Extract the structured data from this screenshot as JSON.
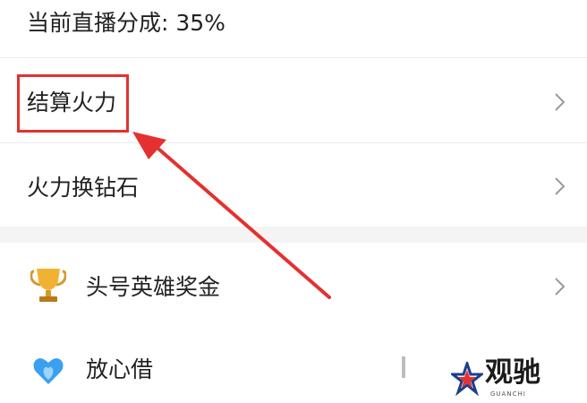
{
  "header": {
    "text": "当前直播分成: 35%"
  },
  "menu": {
    "items": [
      {
        "label": "结算火力",
        "icon": "chevron-right-icon"
      },
      {
        "label": "火力换钻石",
        "icon": "chevron-right-icon"
      }
    ]
  },
  "services": {
    "items": [
      {
        "label": "头号英雄奖金",
        "icon": "trophy-icon"
      },
      {
        "label": "放心借",
        "icon": "heart-drop-icon"
      }
    ]
  },
  "annotation": {
    "box_color": "#e4312f",
    "arrow_color": "#e4312f"
  },
  "watermark": {
    "text": "观驰",
    "subtitle": "GUANCHI",
    "logo": "star-logo-icon"
  }
}
